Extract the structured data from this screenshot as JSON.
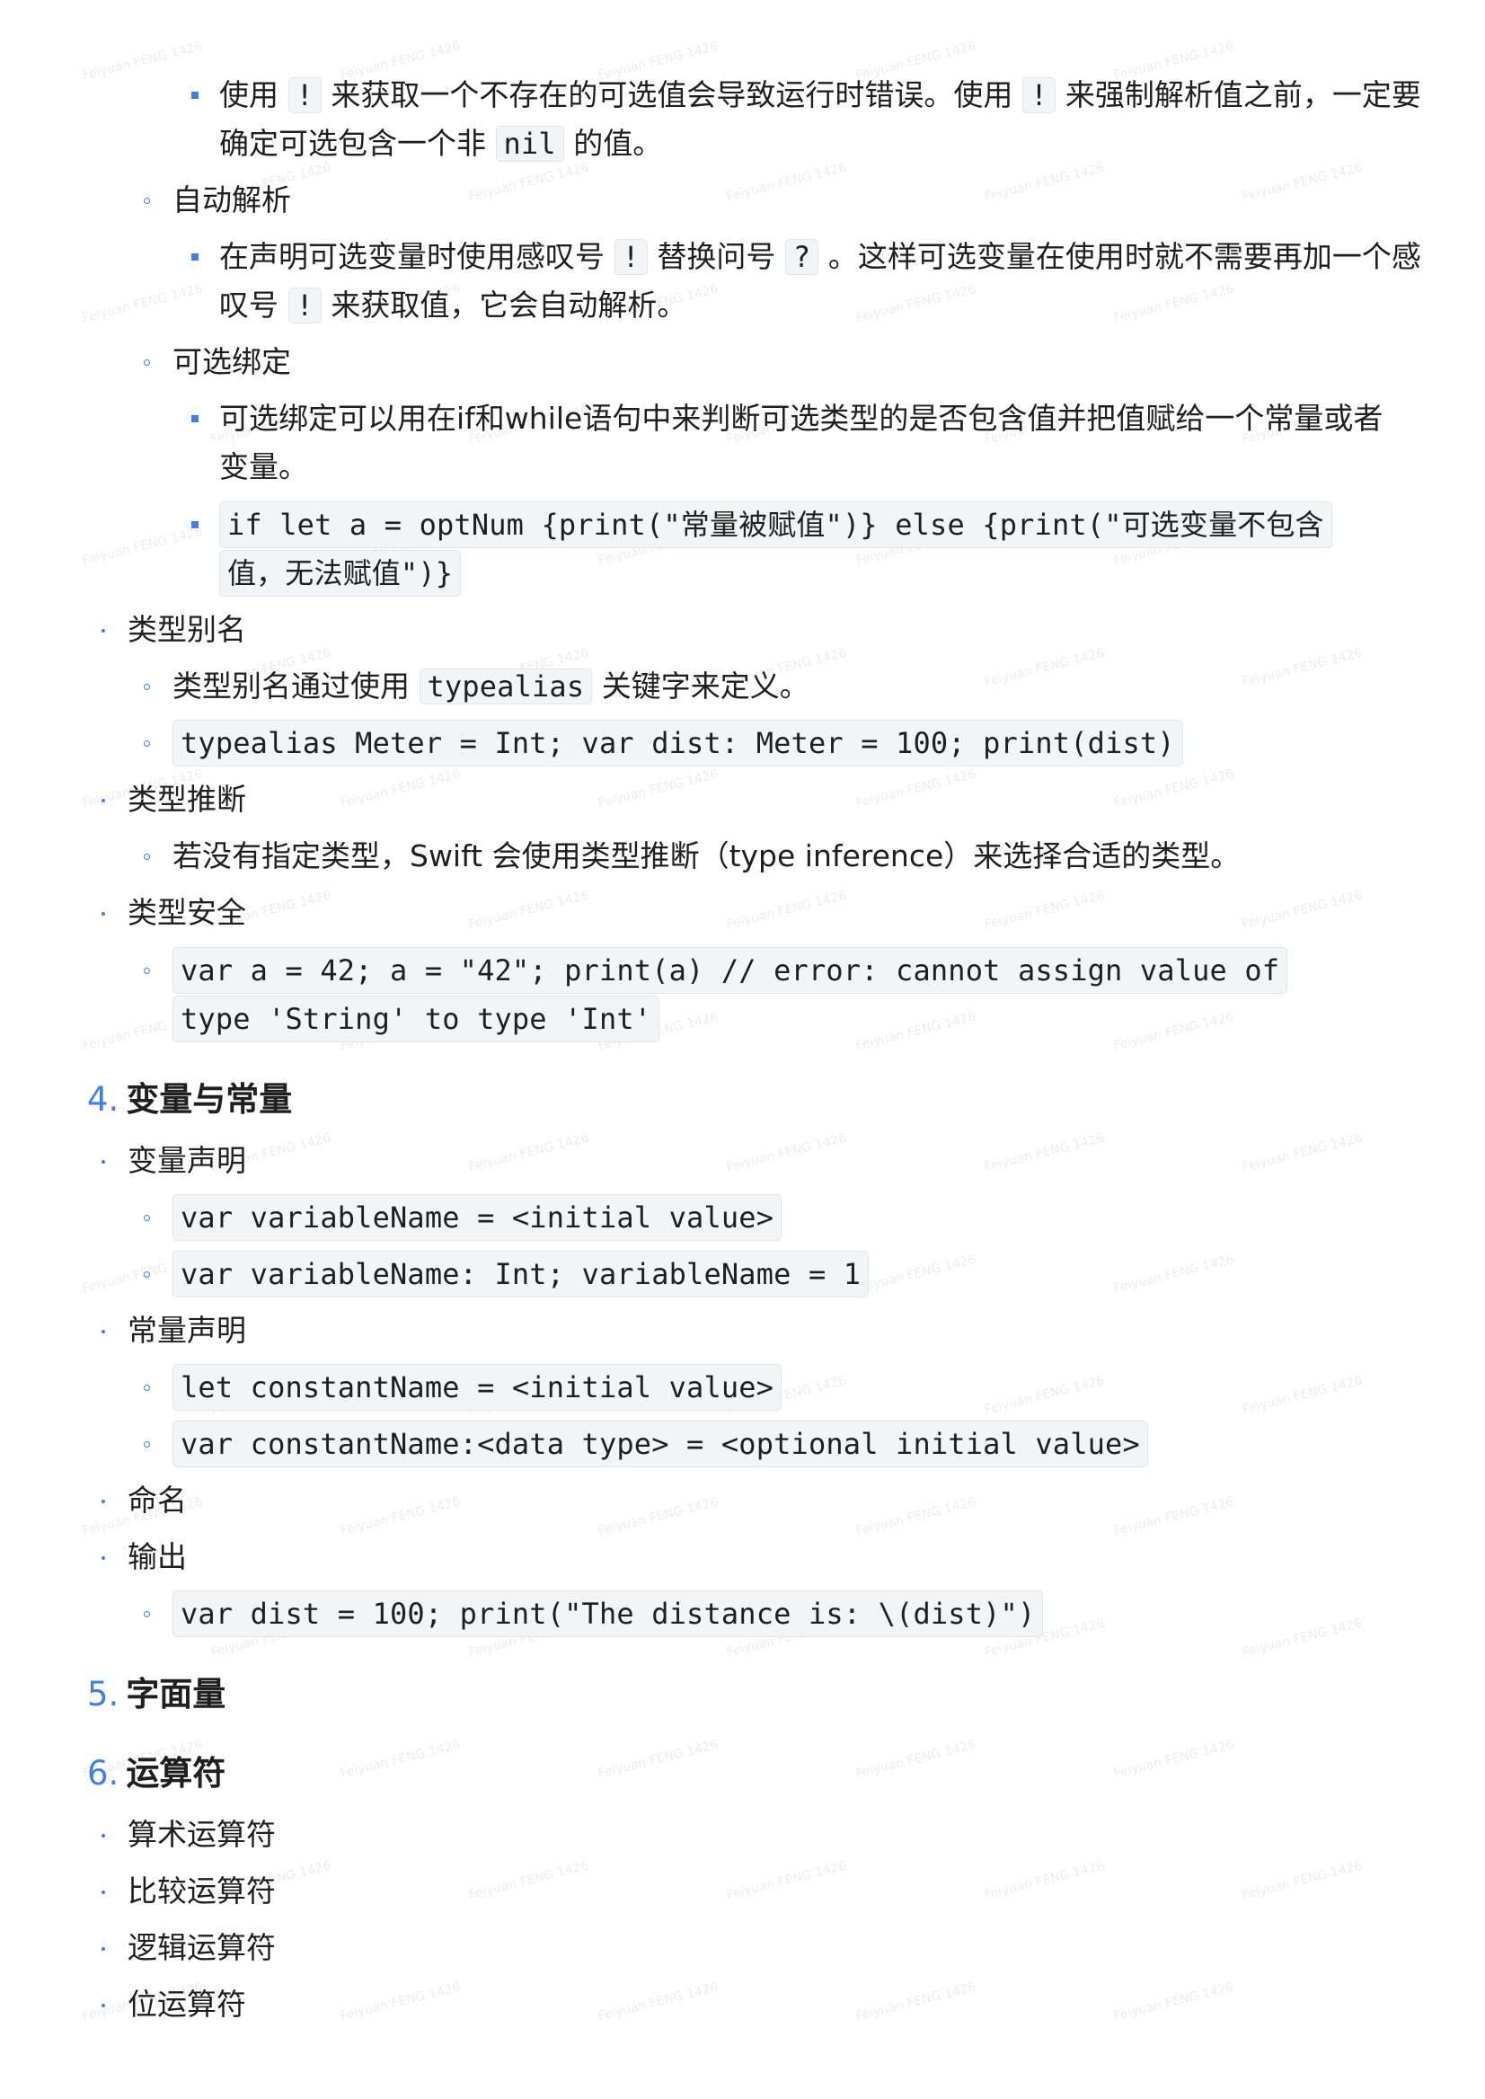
{
  "watermark": "Feiyuan FENG 1426",
  "sections": {
    "optional_force_unwrap_warning": {
      "part1": "使用",
      "code1": "!",
      "part2": "来获取一个不存在的可选值会导致运行时错误。使用",
      "code2": "!",
      "part3": "来强制解析值之前，一定要",
      "line2_part1": "确定可选包含一个非",
      "code3": "nil",
      "line2_part2": "的值。"
    },
    "implicit_unwrap": {
      "label": "自动解析",
      "desc_part1": "在声明可选变量时使用感叹号",
      "code1": "!",
      "desc_part2": "替换问号",
      "code2": "?",
      "desc_part3": "。这样可选变量在使用时就不需要再加一个感",
      "line2_part1": "叹号",
      "code3": "!",
      "line2_part2": "来获取值，它会自动解析。"
    },
    "optional_binding": {
      "label": "可选绑定",
      "desc_line1": "可选绑定可以用在if和while语句中来判断可选类型的是否包含值并把值赋给一个常量或者",
      "desc_line2": "变量。",
      "code_line1": "if let a = optNum {print(\"常量被赋值\")} else {print(\"可选变量不包含",
      "code_line2": "值，无法赋值\")}"
    },
    "type_alias": {
      "label": "类型别名",
      "desc_part1": "类型别名通过使用",
      "code": "typealias",
      "desc_part2": "关键字来定义。",
      "example": "typealias Meter = Int; var dist: Meter = 100; print(dist)"
    },
    "type_inference": {
      "label": "类型推断",
      "desc": "若没有指定类型，Swift 会使用类型推断（type inference）来选择合适的类型。"
    },
    "type_safety": {
      "label": "类型安全",
      "code_line1": "var a = 42; a = \"42\"; print(a) // error: cannot assign value of",
      "code_line2": "type 'String' to type 'Int'"
    }
  },
  "heading4": {
    "number": "4.",
    "title": "变量与常量",
    "var_decl": {
      "label": "变量声明",
      "examples": [
        "var variableName = <initial value>",
        "var variableName: Int; variableName = 1"
      ]
    },
    "const_decl": {
      "label": "常量声明",
      "examples": [
        "let constantName = <initial value>",
        "var constantName:<data type> = <optional initial value>"
      ]
    },
    "naming": {
      "label": "命名"
    },
    "output": {
      "label": "输出",
      "example": "var dist = 100; print(\"The distance is: \\(dist)\")"
    }
  },
  "heading5": {
    "number": "5.",
    "title": "字面量"
  },
  "heading6": {
    "number": "6.",
    "title": "运算符",
    "items": [
      "算术运算符",
      "比较运算符",
      "逻辑运算符",
      "位运算符"
    ]
  }
}
